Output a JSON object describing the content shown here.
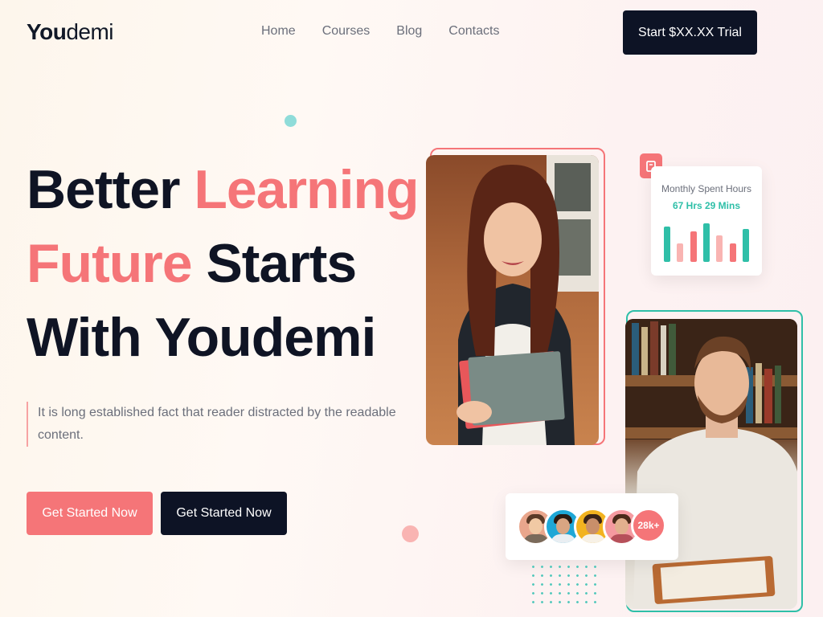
{
  "brand": {
    "logo_strong": "You",
    "logo_light": "demi"
  },
  "nav": {
    "items": [
      "Home",
      "Courses",
      "Blog",
      "Contacts"
    ]
  },
  "header": {
    "trial_button": "Start $XX.XX Trial"
  },
  "hero": {
    "headline": [
      [
        {
          "text": "Better ",
          "style": "dark"
        },
        {
          "text": "Learning",
          "style": "accent"
        }
      ],
      [
        {
          "text": "Future ",
          "style": "accent"
        },
        {
          "text": "Starts",
          "style": "dark"
        }
      ],
      [
        {
          "text": "With Youdemi",
          "style": "dark"
        }
      ]
    ],
    "subtext": "It is long established fact that reader distracted by the readable content.",
    "primary_cta": "Get Started Now",
    "secondary_cta": "Get Started Now"
  },
  "hours_card": {
    "title": "Monthly Spent Hours",
    "value": "67 Hrs 29 Mins",
    "bars": [
      {
        "level": 0.88,
        "color": "#2fbfa8"
      },
      {
        "level": 0.46,
        "color": "#f9b4b2"
      },
      {
        "level": 0.76,
        "color": "#f57578"
      },
      {
        "level": 0.96,
        "color": "#2fbfa8"
      },
      {
        "level": 0.66,
        "color": "#f9b4b2"
      },
      {
        "level": 0.46,
        "color": "#f57578"
      },
      {
        "level": 0.82,
        "color": "#2fbfa8"
      }
    ]
  },
  "community": {
    "count_badge": "28k+"
  },
  "colors": {
    "accent": "#f57578",
    "dark": "#0d1325",
    "teal": "#2fbfa8",
    "light_pink": "#f9b4b2"
  }
}
